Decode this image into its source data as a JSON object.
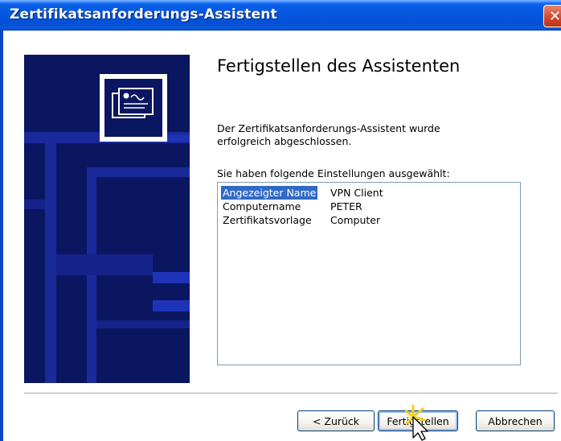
{
  "window": {
    "title": "Zertifikatsanforderungs-Assistent",
    "close_glyph": "✕"
  },
  "main": {
    "heading": "Fertigstellen des Assistenten",
    "description": "Der Zertifikatsanforderungs-Assistent wurde erfolgreich abgeschlossen.",
    "settings_label": "Sie haben folgende Einstellungen ausgewählt:",
    "settings": [
      {
        "key": "Angezeigter Name",
        "value": "VPN Client",
        "selected": true
      },
      {
        "key": "Computername",
        "value": "PETER",
        "selected": false
      },
      {
        "key": "Zertifikatsvorlage",
        "value": "Computer",
        "selected": false
      }
    ]
  },
  "buttons": {
    "back": "< Zurück",
    "finish": "Fertigstellen",
    "cancel": "Abbrechen"
  },
  "icons": {
    "wizard": "certificate-icon",
    "cursor": "mouse-pointer-icon"
  },
  "colors": {
    "titlebar": "#0558e0",
    "side_panel": "#0a1660",
    "selection": "#316ac5",
    "window_bg": "#ece9d8"
  }
}
